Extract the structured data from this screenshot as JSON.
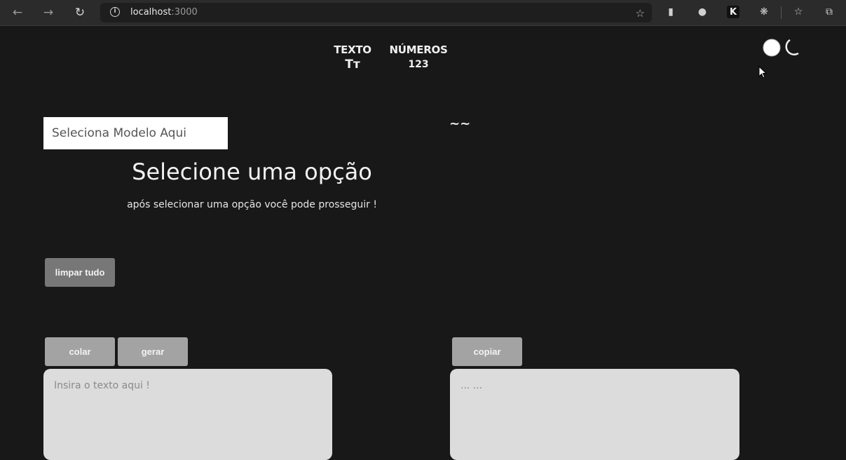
{
  "browser": {
    "url_host": "localhost",
    "url_port": ":3000"
  },
  "nav": {
    "text_label": "TEXTO",
    "text_glyph": "Tт",
    "numbers_label": "NÚMEROS",
    "numbers_glyph": "123"
  },
  "model_select": {
    "value": "Seleciona Modelo Aqui"
  },
  "tilde": "~~",
  "headline": "Selecione uma opção",
  "subline": "após selecionar uma opção você pode prosseguir !",
  "buttons": {
    "clear_all": "limpar tudo",
    "paste": "colar",
    "generate": "gerar",
    "copy": "copiar"
  },
  "input_area": {
    "placeholder": "Insira o texto aqui !"
  },
  "output_area": {
    "placeholder": "... ..."
  },
  "colors": {
    "background": "#181818",
    "button": "#777777",
    "button_light": "#a3a3a3",
    "textarea": "#dcdcdc"
  }
}
